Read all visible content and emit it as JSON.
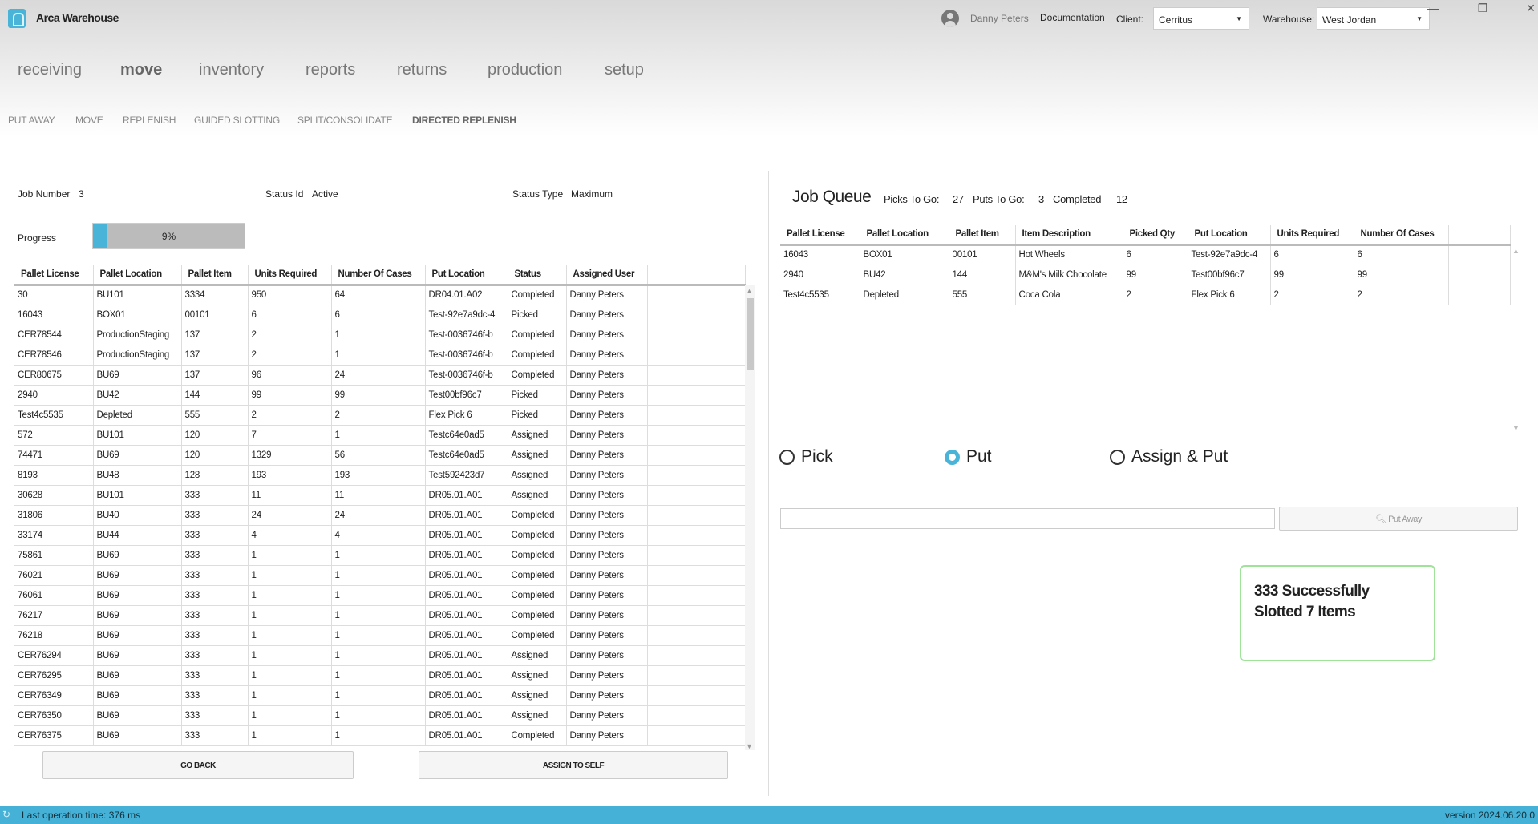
{
  "app": {
    "title": "Arca Warehouse"
  },
  "header": {
    "user": "Danny Peters",
    "documentation": "Documentation",
    "client_label": "Client:",
    "client_value": "Cerritus",
    "warehouse_label": "Warehouse:",
    "warehouse_value": "West Jordan"
  },
  "main_nav": [
    {
      "label": "receiving"
    },
    {
      "label": "move",
      "active": true
    },
    {
      "label": "inventory"
    },
    {
      "label": "reports"
    },
    {
      "label": "returns"
    },
    {
      "label": "production"
    },
    {
      "label": "setup"
    }
  ],
  "sub_nav": [
    {
      "label": "PUT AWAY"
    },
    {
      "label": "MOVE"
    },
    {
      "label": "REPLENISH"
    },
    {
      "label": "GUIDED SLOTTING"
    },
    {
      "label": "SPLIT/CONSOLIDATE"
    },
    {
      "label": "DIRECTED REPLENISH",
      "active": true
    }
  ],
  "job": {
    "job_number_label": "Job Number",
    "job_number": "3",
    "status_id_label": "Status Id",
    "status_id": "Active",
    "status_type_label": "Status Type",
    "status_type": "Maximum",
    "progress_label": "Progress",
    "progress_text": "9%",
    "progress_value": 9
  },
  "left_table": {
    "columns": [
      "Pallet License",
      "Pallet Location",
      "Pallet Item",
      "Units Required",
      "Number Of Cases",
      "Put Location",
      "Status",
      "Assigned User"
    ],
    "rows": [
      [
        "30",
        "BU101",
        "3334",
        "950",
        "64",
        "DR04.01.A02",
        "Completed",
        "Danny Peters"
      ],
      [
        "16043",
        "BOX01",
        "00101",
        "6",
        "6",
        "Test-92e7a9dc-4",
        "Picked",
        "Danny Peters"
      ],
      [
        "CER78544",
        "ProductionStaging",
        "137",
        "2",
        "1",
        "Test-0036746f-b",
        "Completed",
        "Danny Peters"
      ],
      [
        "CER78546",
        "ProductionStaging",
        "137",
        "2",
        "1",
        "Test-0036746f-b",
        "Completed",
        "Danny Peters"
      ],
      [
        "CER80675",
        "BU69",
        "137",
        "96",
        "24",
        "Test-0036746f-b",
        "Completed",
        "Danny Peters"
      ],
      [
        "2940",
        "BU42",
        "144",
        "99",
        "99",
        "Test00bf96c7",
        "Picked",
        "Danny Peters"
      ],
      [
        "Test4c5535",
        "Depleted",
        "555",
        "2",
        "2",
        "Flex Pick 6",
        "Picked",
        "Danny Peters"
      ],
      [
        "572",
        "BU101",
        "120",
        "7",
        "1",
        "Testc64e0ad5",
        "Assigned",
        "Danny Peters"
      ],
      [
        "74471",
        "BU69",
        "120",
        "1329",
        "56",
        "Testc64e0ad5",
        "Assigned",
        "Danny Peters"
      ],
      [
        "8193",
        "BU48",
        "128",
        "193",
        "193",
        "Test592423d7",
        "Assigned",
        "Danny Peters"
      ],
      [
        "30628",
        "BU101",
        "333",
        "11",
        "11",
        "DR05.01.A01",
        "Assigned",
        "Danny Peters"
      ],
      [
        "31806",
        "BU40",
        "333",
        "24",
        "24",
        "DR05.01.A01",
        "Completed",
        "Danny Peters"
      ],
      [
        "33174",
        "BU44",
        "333",
        "4",
        "4",
        "DR05.01.A01",
        "Completed",
        "Danny Peters"
      ],
      [
        "75861",
        "BU69",
        "333",
        "1",
        "1",
        "DR05.01.A01",
        "Completed",
        "Danny Peters"
      ],
      [
        "76021",
        "BU69",
        "333",
        "1",
        "1",
        "DR05.01.A01",
        "Completed",
        "Danny Peters"
      ],
      [
        "76061",
        "BU69",
        "333",
        "1",
        "1",
        "DR05.01.A01",
        "Completed",
        "Danny Peters"
      ],
      [
        "76217",
        "BU69",
        "333",
        "1",
        "1",
        "DR05.01.A01",
        "Completed",
        "Danny Peters"
      ],
      [
        "76218",
        "BU69",
        "333",
        "1",
        "1",
        "DR05.01.A01",
        "Completed",
        "Danny Peters"
      ],
      [
        "CER76294",
        "BU69",
        "333",
        "1",
        "1",
        "DR05.01.A01",
        "Assigned",
        "Danny Peters"
      ],
      [
        "CER76295",
        "BU69",
        "333",
        "1",
        "1",
        "DR05.01.A01",
        "Assigned",
        "Danny Peters"
      ],
      [
        "CER76349",
        "BU69",
        "333",
        "1",
        "1",
        "DR05.01.A01",
        "Assigned",
        "Danny Peters"
      ],
      [
        "CER76350",
        "BU69",
        "333",
        "1",
        "1",
        "DR05.01.A01",
        "Assigned",
        "Danny Peters"
      ],
      [
        "CER76375",
        "BU69",
        "333",
        "1",
        "1",
        "DR05.01.A01",
        "Completed",
        "Danny Peters"
      ]
    ]
  },
  "buttons": {
    "go_back": "GO BACK",
    "assign_to_self": "ASSIGN TO SELF",
    "put_away": "Put Away"
  },
  "job_queue": {
    "title": "Job Queue",
    "picks_label": "Picks To Go:",
    "picks": "27",
    "puts_label": "Puts To Go:",
    "puts": "3",
    "completed_label": "Completed",
    "completed": "12",
    "columns": [
      "Pallet License",
      "Pallet Location",
      "Pallet Item",
      "Item Description",
      "Picked Qty",
      "Put Location",
      "Units Required",
      "Number Of Cases"
    ],
    "rows": [
      [
        "16043",
        "BOX01",
        "00101",
        "Hot Wheels",
        "6",
        "Test-92e7a9dc-4",
        "6",
        "6"
      ],
      [
        "2940",
        "BU42",
        "144",
        "M&M's Milk Chocolate",
        "99",
        "Test00bf96c7",
        "99",
        "99"
      ],
      [
        "Test4c5535",
        "Depleted",
        "555",
        "Coca Cola",
        "2",
        "Flex Pick 6",
        "2",
        "2"
      ]
    ]
  },
  "mode": {
    "options": [
      {
        "label": "Pick",
        "selected": false
      },
      {
        "label": "Put",
        "selected": true
      },
      {
        "label": "Assign & Put",
        "selected": false
      }
    ]
  },
  "scan_input": {
    "value": ""
  },
  "toast": {
    "message": "333 Successfully Slotted 7 Items"
  },
  "status_bar": {
    "last_op": "Last operation time:  376 ms",
    "version": "version 2024.06.20.0"
  },
  "colors": {
    "accent": "#45b1d6",
    "toast_border": "#9fe39b"
  }
}
